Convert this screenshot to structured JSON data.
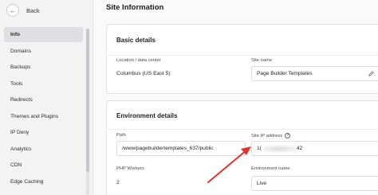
{
  "sidebar": {
    "back_label": "Back",
    "back_icon": "arrow-left-icon",
    "items": [
      {
        "label": "Info",
        "active": true
      },
      {
        "label": "Domains",
        "active": false
      },
      {
        "label": "Backups",
        "active": false
      },
      {
        "label": "Tools",
        "active": false
      },
      {
        "label": "Redirects",
        "active": false
      },
      {
        "label": "Themes and Plugins",
        "active": false
      },
      {
        "label": "IP Deny",
        "active": false
      },
      {
        "label": "Analytics",
        "active": false
      },
      {
        "label": "CDN",
        "active": false
      },
      {
        "label": "Edge Caching",
        "active": false
      }
    ]
  },
  "main": {
    "title": "Site Information",
    "basic": {
      "title": "Basic details",
      "location_label": "Location / data center",
      "location_value": "Columbus (US East 5)",
      "site_name_label": "Site name",
      "site_name_value": "Page Builder Templates"
    },
    "environment": {
      "title": "Environment details",
      "path_label": "Path",
      "path_value": "/www/pagebuildertemplates_637/public",
      "ip_label": "Site IP address",
      "ip_prefix": "1(",
      "ip_suffix": "42",
      "workers_label": "PHP Workers",
      "workers_value": "2",
      "env_name_label": "Environment name",
      "env_name_value": "Live"
    }
  },
  "colors": {
    "annotation_arrow": "#e0342a",
    "active_nav_bg": "#dfdfe3"
  }
}
